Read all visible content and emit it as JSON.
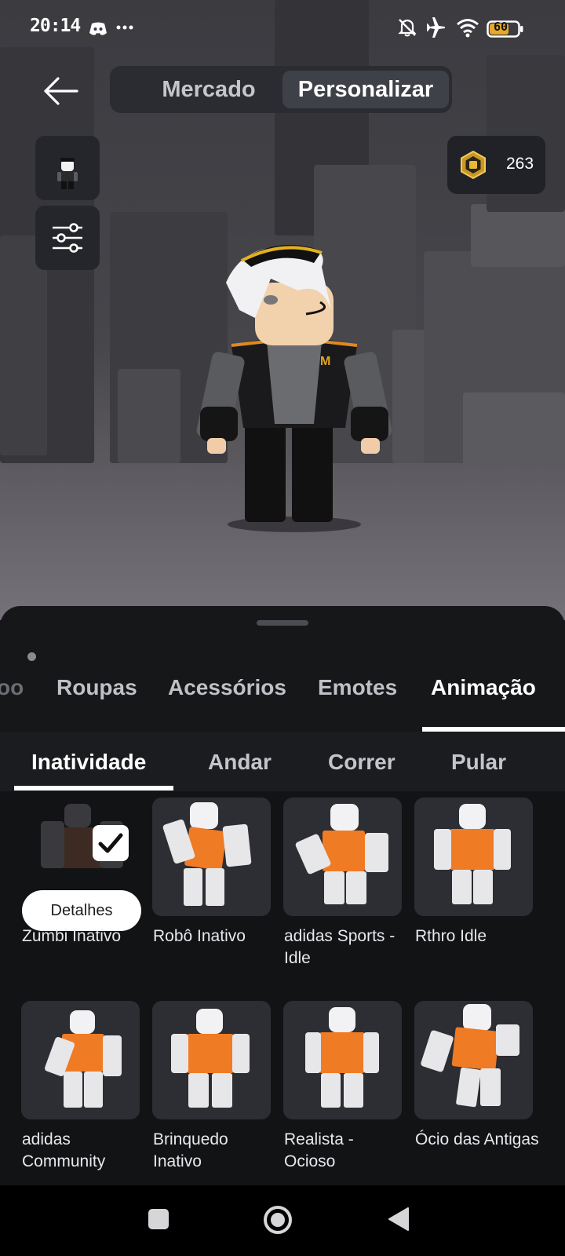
{
  "status_bar": {
    "time": "20:14",
    "left_icons": [
      "discord-icon",
      "more-dots-icon"
    ],
    "right_icons": [
      "bell-off-icon",
      "airplane-icon",
      "wifi-icon",
      "battery-icon"
    ],
    "battery": "60"
  },
  "top_nav": {
    "back_icon": "arrow-left-icon",
    "tabs": [
      {
        "label": "Mercado",
        "selected": false
      },
      {
        "label": "Personalizar",
        "selected": true
      }
    ]
  },
  "side_buttons": [
    "avatar-thumbnail",
    "sliders-icon"
  ],
  "currency": {
    "icon": "robux-icon",
    "amount": "263"
  },
  "categories": {
    "items": [
      {
        "label": "Roupas",
        "active": false
      },
      {
        "label": "Acessórios",
        "active": false
      },
      {
        "label": "Emotes",
        "active": false
      },
      {
        "label": "Animação",
        "active": true
      }
    ],
    "partial_left": "oo"
  },
  "subcategories": {
    "items": [
      {
        "label": "Inatividade",
        "active": true
      },
      {
        "label": "Andar",
        "active": false
      },
      {
        "label": "Correr",
        "active": false
      },
      {
        "label": "Pular",
        "active": false
      }
    ]
  },
  "grid": {
    "details_label": "Detalhes",
    "items": [
      {
        "name": "Zumbi Inativo",
        "selected": true
      },
      {
        "name": "Robô Inativo",
        "selected": false
      },
      {
        "name": "adidas Sports - Idle",
        "selected": false
      },
      {
        "name": "Rthro Idle",
        "selected": false
      },
      {
        "name": "adidas Community",
        "selected": false
      },
      {
        "name": "Brinquedo Inativo",
        "selected": false
      },
      {
        "name": "Realista - Ocioso",
        "selected": false
      },
      {
        "name": "Ócio das Antigas",
        "selected": false
      }
    ]
  },
  "nav_bar": [
    "square-recent-icon",
    "circle-home-icon",
    "triangle-back-icon"
  ],
  "colors": {
    "accent_gold": "#d9a93c",
    "sheet_bg": "#161719",
    "tile_bg": "#2d2e33",
    "avatar_orange": "#f07b25"
  }
}
